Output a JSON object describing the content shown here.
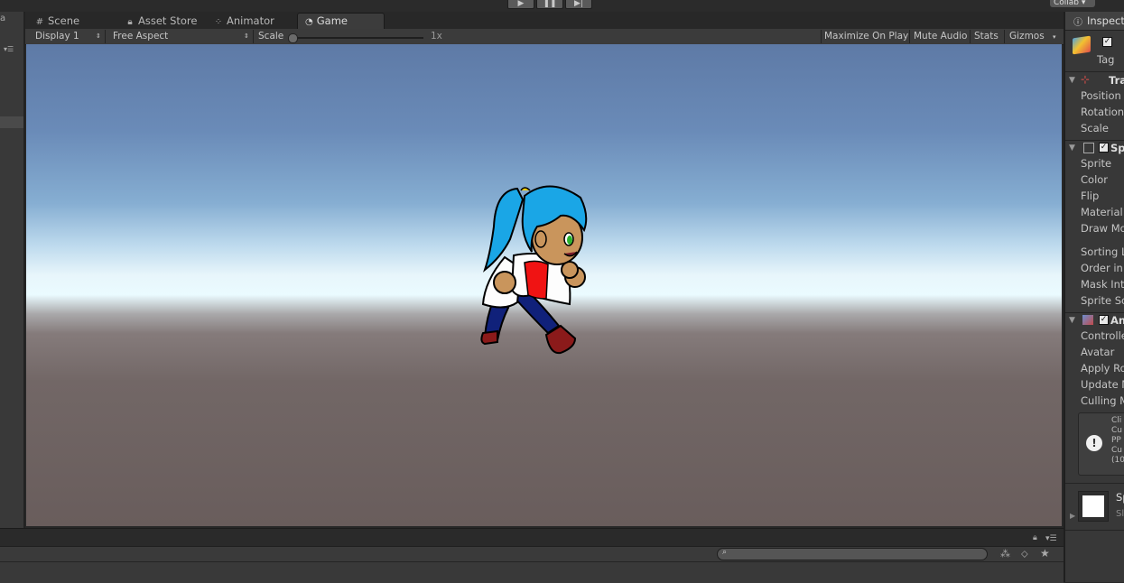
{
  "top": {
    "collab_label": "Collab ▾"
  },
  "tabs": [
    {
      "label": "Scene"
    },
    {
      "label": "Asset Store"
    },
    {
      "label": "Animator"
    },
    {
      "label": "Game"
    }
  ],
  "toolbar": {
    "display": "Display 1",
    "aspect": "Free Aspect",
    "scale_label": "Scale",
    "scale_value": "1x",
    "maximize": "Maximize On Play",
    "mute": "Mute Audio",
    "stats": "Stats",
    "gizmos": "Gizmos"
  },
  "inspector": {
    "tab_label": "Inspect",
    "tag_label": "Tag",
    "transform": {
      "header": "Tra",
      "props": [
        "Position",
        "Rotation",
        "Scale"
      ]
    },
    "sprite_renderer": {
      "header": "Sp",
      "props": [
        "Sprite",
        "Color",
        "Flip",
        "Material",
        "Draw Mo",
        "Sorting L",
        "Order in",
        "Mask Int",
        "Sprite So"
      ]
    },
    "animator": {
      "header": "An",
      "props": [
        "Controlle",
        "Avatar",
        "Apply Ro",
        "Update M",
        "Culling M"
      ]
    },
    "info_lines": [
      "Cli",
      "Cu",
      "PP",
      "Cu",
      "(10"
    ],
    "material": {
      "name": "Sp",
      "shader": "Sl"
    }
  },
  "colors": {
    "accent_checkbox": "#e8e8e8",
    "sky_top": "#5e7aa6",
    "horizon": "#eafbff",
    "ground": "#695d5c"
  }
}
